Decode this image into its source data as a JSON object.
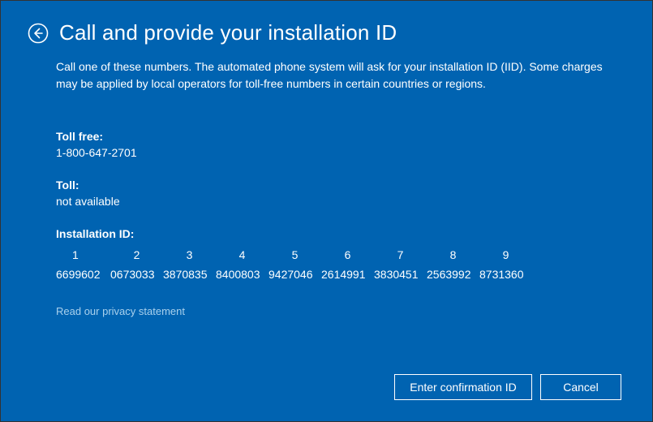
{
  "header": {
    "title": "Call and provide your installation ID"
  },
  "intro": "Call one of these numbers. The automated phone system will ask for your installation ID (IID). Some charges may be applied by local operators for toll-free numbers in certain countries or regions.",
  "toll_free": {
    "label": "Toll free:",
    "value": "1-800-647-2701"
  },
  "toll": {
    "label": "Toll:",
    "value": "not available"
  },
  "installation_id": {
    "label": "Installation ID:",
    "heads": [
      "1",
      "2",
      "3",
      "4",
      "5",
      "6",
      "7",
      "8",
      "9"
    ],
    "values": [
      "6699602",
      "0673033",
      "3870835",
      "8400803",
      "9427046",
      "2614991",
      "3830451",
      "2563992",
      "8731360"
    ]
  },
  "privacy_link": "Read our privacy statement",
  "buttons": {
    "primary": "Enter confirmation ID",
    "cancel": "Cancel"
  }
}
